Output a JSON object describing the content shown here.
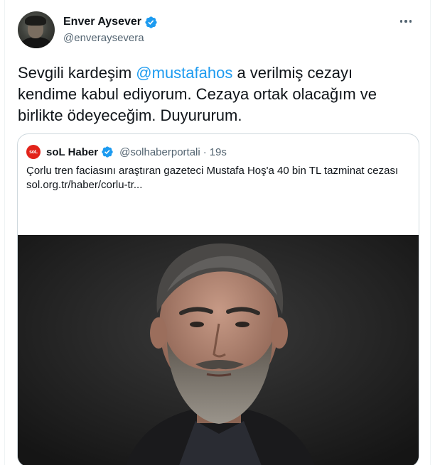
{
  "author": {
    "display_name": "Enver Aysever",
    "handle": "@enveraysevera",
    "verified": true
  },
  "tweet": {
    "text_before": "Sevgili kardeşim ",
    "mention": "@mustafahos",
    "text_after": " a verilmiş cezayı kendime kabul ediyorum. Cezaya ortak olacağım ve birlikte ödeyeceğim. Duyururum."
  },
  "quoted_tweet": {
    "logo_text": "soL",
    "display_name": "soL Haber",
    "handle": "@solhaberportali",
    "separator": "·",
    "time": "19s",
    "text": "Çorlu tren faciasını araştıran gazeteci Mustafa Hoş'a 40 bin TL tazminat cezası",
    "link": "sol.org.tr/haber/corlu-tr..."
  },
  "colors": {
    "accent": "#1d9bf0",
    "verified_badge": "#1d9bf0",
    "logo_red": "#e2231a",
    "secondary_text": "#536471"
  },
  "icons": {
    "verified": "verified-badge-icon",
    "more": "more-options-icon"
  }
}
